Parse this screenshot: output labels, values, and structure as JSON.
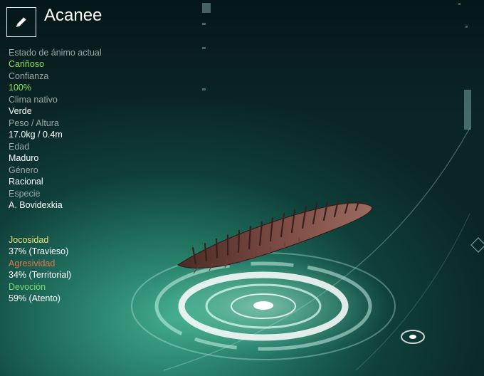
{
  "creature": {
    "name": "Acanee"
  },
  "stats": [
    {
      "label": "Estado de ánimo actual",
      "value": "Cariñoso",
      "value_color": "green"
    },
    {
      "label": "Confianza",
      "value": "100%",
      "value_color": "green"
    },
    {
      "label": "Clima nativo",
      "value": "Verde",
      "value_color": "white"
    },
    {
      "label": "Peso / Altura",
      "value": "17.0kg / 0.4m",
      "value_color": "white"
    },
    {
      "label": "Edad",
      "value": "Maduro",
      "value_color": "white"
    },
    {
      "label": "Género",
      "value": "Racional",
      "value_color": "white"
    },
    {
      "label": "Especie",
      "value": "A. Bovidexkia",
      "value_color": "white"
    }
  ],
  "traits": [
    {
      "label": "Jocosidad",
      "value": "37% (Travieso)",
      "color": "#e8e27a"
    },
    {
      "label": "Agresividad",
      "value": "34% (Territorial)",
      "color": "#e07a4c"
    },
    {
      "label": "Devoción",
      "value": "59% (Atento)",
      "color": "#7fdc6e"
    }
  ],
  "icons": {
    "edit": "pencil-icon"
  },
  "colors": {
    "accent_green": "#8ce65c",
    "label_gray": "#9aa8a6"
  }
}
